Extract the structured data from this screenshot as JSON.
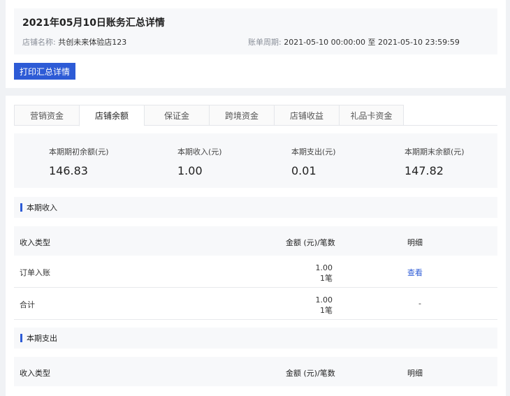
{
  "header": {
    "title": "2021年05月10日账务汇总详情",
    "store_label": "店铺名称:",
    "store_name": "共创未来体验店123",
    "period_label": "账单周期:",
    "period_value": "2021-05-10 00:00:00 至 2021-05-10 23:59:59",
    "print_button": "打印汇总详情"
  },
  "tabs": [
    {
      "label": "营销资金",
      "active": false
    },
    {
      "label": "店铺余额",
      "active": true
    },
    {
      "label": "保证金",
      "active": false
    },
    {
      "label": "跨境资金",
      "active": false
    },
    {
      "label": "店铺收益",
      "active": false
    },
    {
      "label": "礼品卡资金",
      "active": false
    }
  ],
  "stats": [
    {
      "label": "本期期初余额(元)",
      "value": "146.83"
    },
    {
      "label": "本期收入(元)",
      "value": "1.00"
    },
    {
      "label": "本期支出(元)",
      "value": "0.01"
    },
    {
      "label": "本期期末余额(元)",
      "value": "147.82"
    }
  ],
  "income": {
    "section_title": "本期收入",
    "columns": [
      "收入类型",
      "金额 (元)/笔数",
      "明细"
    ],
    "rows": [
      {
        "type": "订单入账",
        "amount": "1.00",
        "count": "1笔",
        "detail": "查看"
      },
      {
        "type": "合计",
        "amount": "1.00",
        "count": "1笔",
        "detail": "-"
      }
    ]
  },
  "expense": {
    "section_title": "本期支出",
    "columns": [
      "收入类型",
      "金额 (元)/笔数",
      "明细"
    ]
  },
  "colors": {
    "accent": "#2d5bd6",
    "panel_bg": "#f7f8fa",
    "page_bg": "#f0f2f5"
  }
}
